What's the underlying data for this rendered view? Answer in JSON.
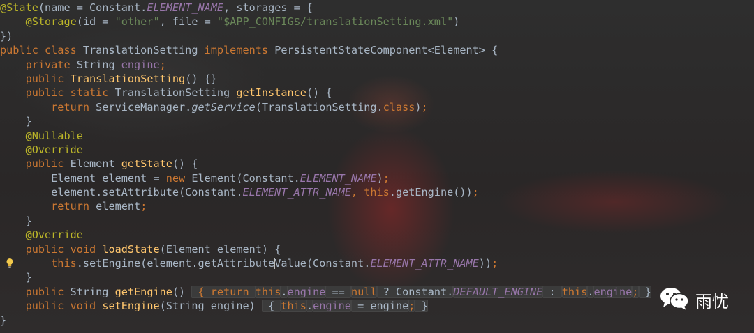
{
  "editor": {
    "lines": [
      [
        [
          "ann",
          "@State"
        ],
        [
          "p",
          "(name = Constant."
        ],
        [
          "cst",
          "ELEMENT_NAME"
        ],
        [
          "p",
          ", storages = {"
        ]
      ],
      [
        [
          "p",
          "    "
        ],
        [
          "ann",
          "@Storage"
        ],
        [
          "p",
          "(id = "
        ],
        [
          "str",
          "\"other\""
        ],
        [
          "p",
          ", file = "
        ],
        [
          "str",
          "\"$APP_CONFIG$/translationSetting.xml\""
        ],
        [
          "p",
          ")"
        ]
      ],
      [
        [
          "p",
          "})"
        ]
      ],
      [
        [
          "kw",
          "public class "
        ],
        [
          "p",
          "TranslationSetting "
        ],
        [
          "kw",
          "implements "
        ],
        [
          "p",
          "PersistentStateComponent<Element> {"
        ]
      ],
      [
        [
          "p",
          "    "
        ],
        [
          "kw",
          "private "
        ],
        [
          "p",
          "String "
        ],
        [
          "fld",
          "engine"
        ],
        [
          "kw",
          ";"
        ]
      ],
      [
        [
          "p",
          "    "
        ],
        [
          "kw",
          "public "
        ],
        [
          "fn",
          "TranslationSetting"
        ],
        [
          "p",
          "() {}"
        ]
      ],
      [
        [
          "p",
          "    "
        ],
        [
          "kw",
          "public static "
        ],
        [
          "p",
          "TranslationSetting "
        ],
        [
          "fn",
          "getInstance"
        ],
        [
          "p",
          "() {"
        ]
      ],
      [
        [
          "p",
          "        "
        ],
        [
          "kw",
          "return "
        ],
        [
          "p",
          "ServiceManager."
        ],
        [
          "it",
          "getService"
        ],
        [
          "p",
          "(TranslationSetting."
        ],
        [
          "kw",
          "class"
        ],
        [
          "p",
          ")"
        ],
        [
          "kw",
          ";"
        ]
      ],
      [
        [
          "p",
          "    }"
        ]
      ],
      [
        [
          "p",
          "    "
        ],
        [
          "ann",
          "@Nullable"
        ]
      ],
      [
        [
          "p",
          "    "
        ],
        [
          "ann",
          "@Override"
        ]
      ],
      [
        [
          "p",
          "    "
        ],
        [
          "kw",
          "public "
        ],
        [
          "p",
          "Element "
        ],
        [
          "fn",
          "getState"
        ],
        [
          "p",
          "() {"
        ]
      ],
      [
        [
          "p",
          "        Element element = "
        ],
        [
          "kw",
          "new "
        ],
        [
          "p",
          "Element(Constant."
        ],
        [
          "cst",
          "ELEMENT_NAME"
        ],
        [
          "p",
          ")"
        ],
        [
          "kw",
          ";"
        ]
      ],
      [
        [
          "p",
          "        element.setAttribute(Constant."
        ],
        [
          "cst",
          "ELEMENT_ATTR_NAME"
        ],
        [
          "kw",
          ", this"
        ],
        [
          "p",
          ".getEngine())"
        ],
        [
          "kw",
          ";"
        ]
      ],
      [
        [
          "p",
          "        "
        ],
        [
          "kw",
          "return "
        ],
        [
          "p",
          "element"
        ],
        [
          "kw",
          ";"
        ]
      ],
      [
        [
          "p",
          "    }"
        ]
      ],
      [
        [
          "p",
          "    "
        ],
        [
          "ann",
          "@Override"
        ]
      ],
      [
        [
          "p",
          "    "
        ],
        [
          "kw",
          "public void "
        ],
        [
          "fn",
          "loadState"
        ],
        [
          "p",
          "(Element element) {"
        ]
      ],
      [
        [
          "p",
          "        "
        ],
        [
          "kw",
          "this"
        ],
        [
          "p",
          ".setEngine(element.getAttribute"
        ],
        [
          "caret",
          ""
        ],
        [
          "p",
          "Value(Constant."
        ],
        [
          "cst",
          "ELEMENT_ATTR_NAME"
        ],
        [
          "p",
          "))"
        ],
        [
          "kw",
          ";"
        ]
      ],
      [
        [
          "p",
          "    }"
        ]
      ],
      [
        [
          "p",
          "    "
        ],
        [
          "kw",
          "public "
        ],
        [
          "p",
          "String "
        ],
        [
          "fn",
          "getEngine"
        ],
        [
          "p",
          "() "
        ],
        [
          "foldkw",
          " { return "
        ],
        [
          "foldkwthis",
          "this"
        ],
        [
          "fold",
          "."
        ],
        [
          "foldfld",
          "engine"
        ],
        [
          "fold",
          " == "
        ],
        [
          "foldkw",
          "null"
        ],
        [
          "fold",
          " ? Constant."
        ],
        [
          "foldcst",
          "DEFAULT_ENGINE"
        ],
        [
          "fold",
          " : "
        ],
        [
          "foldkw",
          "this"
        ],
        [
          "fold",
          "."
        ],
        [
          "foldfld",
          "engine"
        ],
        [
          "foldkw",
          ";"
        ],
        [
          "fold",
          " }"
        ]
      ],
      [
        [
          "p",
          "    "
        ],
        [
          "kw",
          "public void "
        ],
        [
          "fn",
          "setEngine"
        ],
        [
          "p",
          "(String engine) "
        ],
        [
          "fold",
          " { "
        ],
        [
          "foldkw",
          "this"
        ],
        [
          "fold",
          "."
        ],
        [
          "foldfld",
          "engine"
        ],
        [
          "fold",
          " = engine"
        ],
        [
          "foldkw",
          ";"
        ],
        [
          "fold",
          " }"
        ]
      ],
      [
        [
          "p",
          "}"
        ]
      ]
    ]
  },
  "gutter": {
    "intention_icon_line": 18,
    "intention_icon": "lightbulb-icon"
  },
  "watermark": {
    "icon": "wechat-icon",
    "label": "雨忧"
  }
}
